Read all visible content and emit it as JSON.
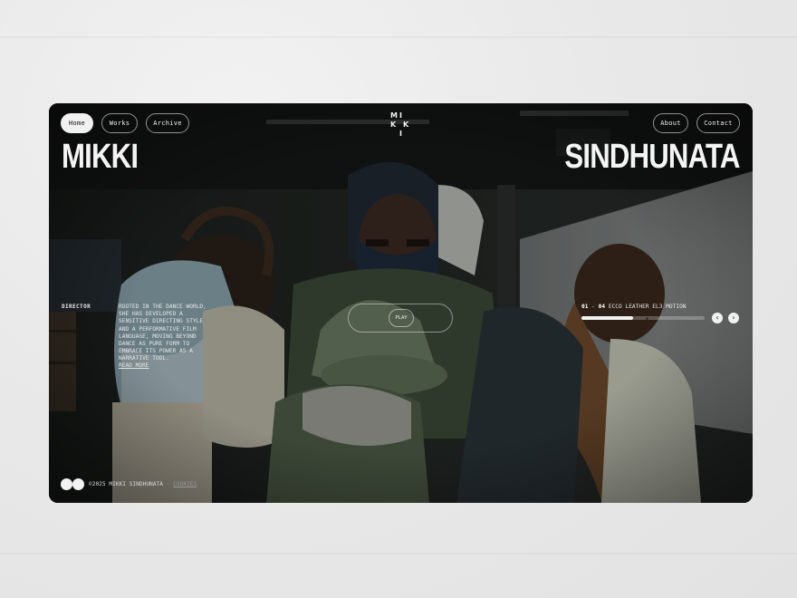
{
  "nav": {
    "left": [
      {
        "label": "Home",
        "active": true
      },
      {
        "label": "Works",
        "active": false
      },
      {
        "label": "Archive",
        "active": false
      }
    ],
    "right": [
      {
        "label": "About"
      },
      {
        "label": "Contact"
      }
    ]
  },
  "logo": {
    "letters": [
      "M",
      "I",
      "K",
      "K",
      "I"
    ]
  },
  "hero": {
    "first_name": "MIKKI",
    "last_name": "SINDHUNATA"
  },
  "about": {
    "role": "DIRECTOR",
    "bio": "ROOTED IN THE DANCE WORLD, SHE HAS DEVELOPED A SENSITIVE DIRECTING STYLE AND A PERFORMATIVE FILM LANGUAGE, MOVING BEYOND DANCE AS PURE FORM TO EMBRACE ITS POWER AS A NARRATIVE TOOL.",
    "read_more": "READ MORE"
  },
  "player": {
    "play_label": "PLAY"
  },
  "slider": {
    "current": "01",
    "separator": "-",
    "total": "04",
    "title": "ECCO LEATHER EL3 MOTION",
    "progress": 0.42,
    "prev_icon": "chevron-left-icon",
    "next_icon": "chevron-right-icon"
  },
  "footer": {
    "copyright": "©2025 MIKKI SINDHUNATA",
    "separator": "·",
    "cookies": "COOKIES"
  },
  "colors": {
    "background": "#e9e9e9",
    "text_light": "#f1f1f1",
    "frame_dark": "#1b1f1d"
  }
}
